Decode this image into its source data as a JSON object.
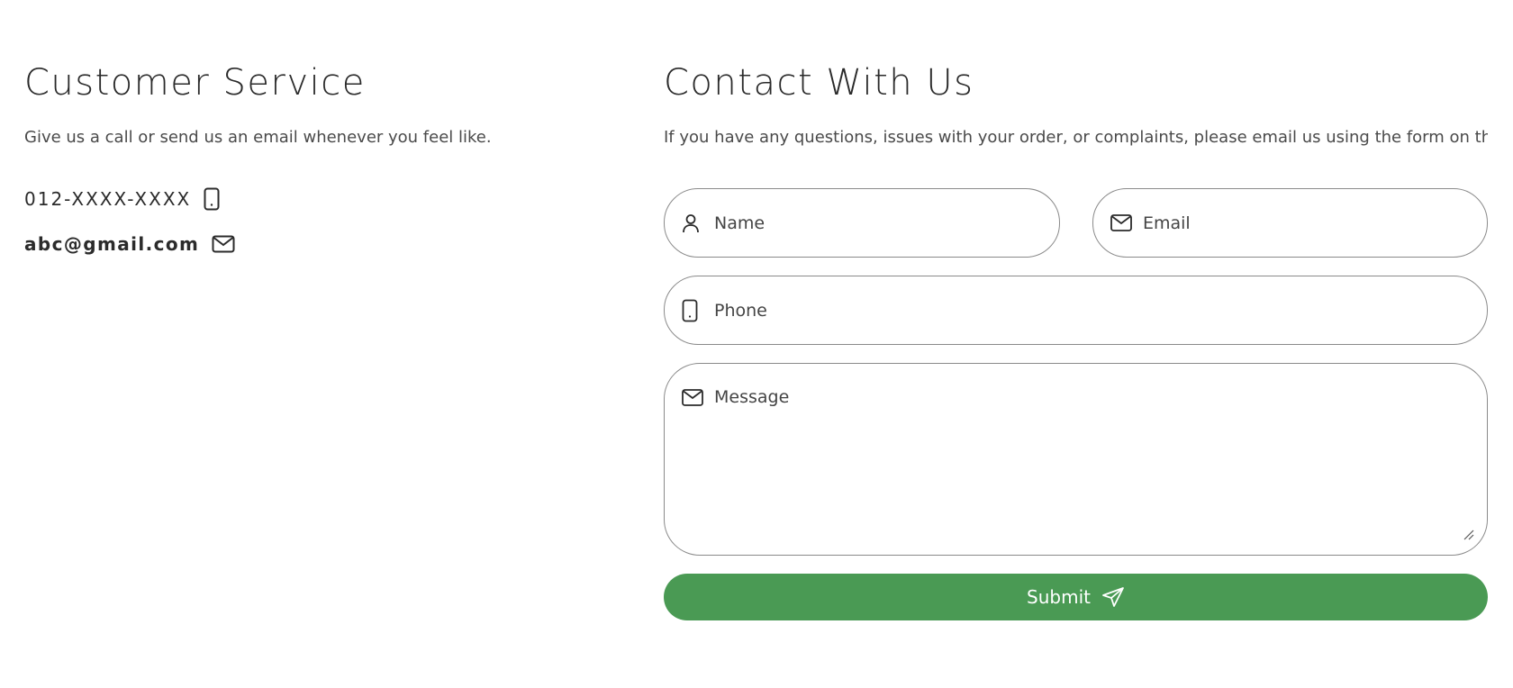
{
  "customer_service": {
    "title": "Customer Service",
    "description": "Give us a call or send us an email whenever you feel like.",
    "phone": "012-XXXX-XXXX",
    "phone_icon": "phone-icon",
    "email": "abc@gmail.com",
    "email_icon": "mail-icon"
  },
  "contact_form": {
    "title": "Contact With Us",
    "description": "If you have any questions, issues with your order, or complaints, please email us using the form on this",
    "name_placeholder": "Name",
    "email_placeholder": "Email",
    "phone_placeholder": "Phone",
    "message_placeholder": "Message",
    "submit_label": "Submit",
    "submit_icon": "send-icon"
  },
  "colors": {
    "accent": "#4a9a54",
    "border": "#8a8a8a",
    "text": "#2b2b2b"
  }
}
